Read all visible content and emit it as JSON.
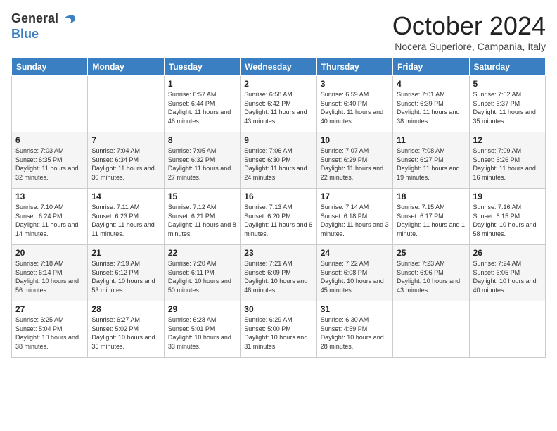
{
  "logo": {
    "text_general": "General",
    "text_blue": "Blue"
  },
  "header": {
    "month": "October 2024",
    "location": "Nocera Superiore, Campania, Italy"
  },
  "days_of_week": [
    "Sunday",
    "Monday",
    "Tuesday",
    "Wednesday",
    "Thursday",
    "Friday",
    "Saturday"
  ],
  "weeks": [
    [
      {
        "day": "",
        "info": ""
      },
      {
        "day": "",
        "info": ""
      },
      {
        "day": "1",
        "info": "Sunrise: 6:57 AM\nSunset: 6:44 PM\nDaylight: 11 hours and 46 minutes."
      },
      {
        "day": "2",
        "info": "Sunrise: 6:58 AM\nSunset: 6:42 PM\nDaylight: 11 hours and 43 minutes."
      },
      {
        "day": "3",
        "info": "Sunrise: 6:59 AM\nSunset: 6:40 PM\nDaylight: 11 hours and 40 minutes."
      },
      {
        "day": "4",
        "info": "Sunrise: 7:01 AM\nSunset: 6:39 PM\nDaylight: 11 hours and 38 minutes."
      },
      {
        "day": "5",
        "info": "Sunrise: 7:02 AM\nSunset: 6:37 PM\nDaylight: 11 hours and 35 minutes."
      }
    ],
    [
      {
        "day": "6",
        "info": "Sunrise: 7:03 AM\nSunset: 6:35 PM\nDaylight: 11 hours and 32 minutes."
      },
      {
        "day": "7",
        "info": "Sunrise: 7:04 AM\nSunset: 6:34 PM\nDaylight: 11 hours and 30 minutes."
      },
      {
        "day": "8",
        "info": "Sunrise: 7:05 AM\nSunset: 6:32 PM\nDaylight: 11 hours and 27 minutes."
      },
      {
        "day": "9",
        "info": "Sunrise: 7:06 AM\nSunset: 6:30 PM\nDaylight: 11 hours and 24 minutes."
      },
      {
        "day": "10",
        "info": "Sunrise: 7:07 AM\nSunset: 6:29 PM\nDaylight: 11 hours and 22 minutes."
      },
      {
        "day": "11",
        "info": "Sunrise: 7:08 AM\nSunset: 6:27 PM\nDaylight: 11 hours and 19 minutes."
      },
      {
        "day": "12",
        "info": "Sunrise: 7:09 AM\nSunset: 6:26 PM\nDaylight: 11 hours and 16 minutes."
      }
    ],
    [
      {
        "day": "13",
        "info": "Sunrise: 7:10 AM\nSunset: 6:24 PM\nDaylight: 11 hours and 14 minutes."
      },
      {
        "day": "14",
        "info": "Sunrise: 7:11 AM\nSunset: 6:23 PM\nDaylight: 11 hours and 11 minutes."
      },
      {
        "day": "15",
        "info": "Sunrise: 7:12 AM\nSunset: 6:21 PM\nDaylight: 11 hours and 8 minutes."
      },
      {
        "day": "16",
        "info": "Sunrise: 7:13 AM\nSunset: 6:20 PM\nDaylight: 11 hours and 6 minutes."
      },
      {
        "day": "17",
        "info": "Sunrise: 7:14 AM\nSunset: 6:18 PM\nDaylight: 11 hours and 3 minutes."
      },
      {
        "day": "18",
        "info": "Sunrise: 7:15 AM\nSunset: 6:17 PM\nDaylight: 11 hours and 1 minute."
      },
      {
        "day": "19",
        "info": "Sunrise: 7:16 AM\nSunset: 6:15 PM\nDaylight: 10 hours and 58 minutes."
      }
    ],
    [
      {
        "day": "20",
        "info": "Sunrise: 7:18 AM\nSunset: 6:14 PM\nDaylight: 10 hours and 56 minutes."
      },
      {
        "day": "21",
        "info": "Sunrise: 7:19 AM\nSunset: 6:12 PM\nDaylight: 10 hours and 53 minutes."
      },
      {
        "day": "22",
        "info": "Sunrise: 7:20 AM\nSunset: 6:11 PM\nDaylight: 10 hours and 50 minutes."
      },
      {
        "day": "23",
        "info": "Sunrise: 7:21 AM\nSunset: 6:09 PM\nDaylight: 10 hours and 48 minutes."
      },
      {
        "day": "24",
        "info": "Sunrise: 7:22 AM\nSunset: 6:08 PM\nDaylight: 10 hours and 45 minutes."
      },
      {
        "day": "25",
        "info": "Sunrise: 7:23 AM\nSunset: 6:06 PM\nDaylight: 10 hours and 43 minutes."
      },
      {
        "day": "26",
        "info": "Sunrise: 7:24 AM\nSunset: 6:05 PM\nDaylight: 10 hours and 40 minutes."
      }
    ],
    [
      {
        "day": "27",
        "info": "Sunrise: 6:25 AM\nSunset: 5:04 PM\nDaylight: 10 hours and 38 minutes."
      },
      {
        "day": "28",
        "info": "Sunrise: 6:27 AM\nSunset: 5:02 PM\nDaylight: 10 hours and 35 minutes."
      },
      {
        "day": "29",
        "info": "Sunrise: 6:28 AM\nSunset: 5:01 PM\nDaylight: 10 hours and 33 minutes."
      },
      {
        "day": "30",
        "info": "Sunrise: 6:29 AM\nSunset: 5:00 PM\nDaylight: 10 hours and 31 minutes."
      },
      {
        "day": "31",
        "info": "Sunrise: 6:30 AM\nSunset: 4:59 PM\nDaylight: 10 hours and 28 minutes."
      },
      {
        "day": "",
        "info": ""
      },
      {
        "day": "",
        "info": ""
      }
    ]
  ]
}
